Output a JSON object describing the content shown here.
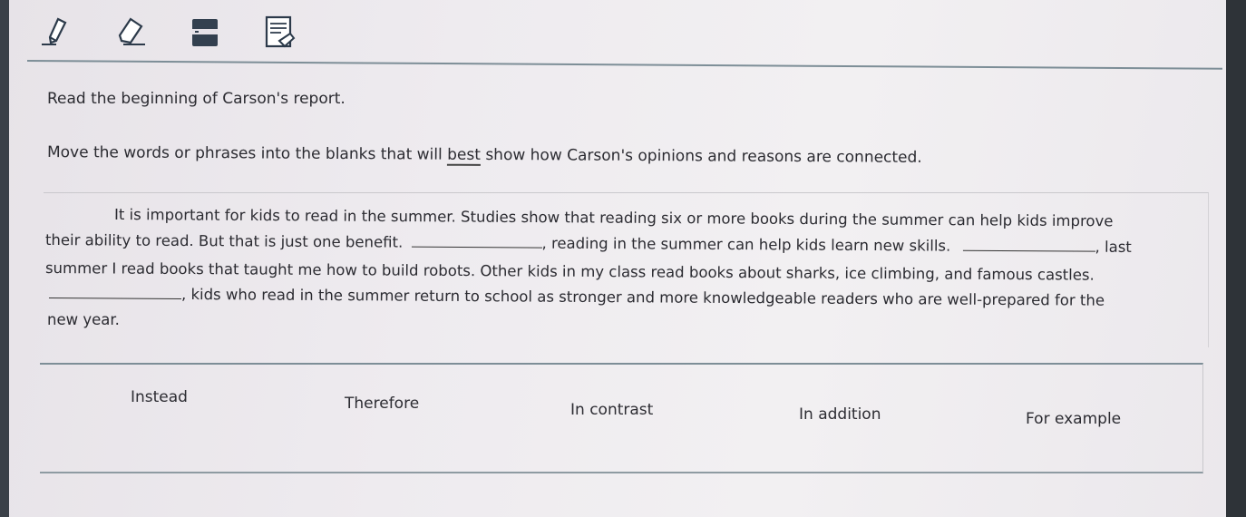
{
  "toolbar": {
    "tools": [
      "pencil-icon",
      "eraser-icon",
      "line-reader-icon",
      "notepad-icon"
    ]
  },
  "question": {
    "intro": "Read the beginning of Carson's report.",
    "instruction_before": "Move the words or phrases into the blanks that will ",
    "instruction_emphasis": "best",
    "instruction_after": " show how Carson's opinions and reasons are connected."
  },
  "passage": {
    "line1": "It is important for kids to read in the summer. Studies show that reading six or more books during the summer can help kids improve",
    "line2_a": "their ability to read. But that is just one benefit.",
    "line2_b": ", reading in the summer can help kids learn new skills.",
    "line2_c": ", last",
    "line3": "summer I read books that taught me how to build robots. Other kids in my class read books about sharks, ice climbing, and famous castles.",
    "line4": ", kids who read in the summer return to school as stronger and more knowledgeable readers who are well-prepared for the",
    "line5": "new year."
  },
  "word_bank": [
    "Instead",
    "Therefore",
    "In contrast",
    "In addition",
    "For example"
  ],
  "colors": {
    "rule": "#7d8e97",
    "text": "#2d2d33",
    "bezel": "#3a4048"
  }
}
